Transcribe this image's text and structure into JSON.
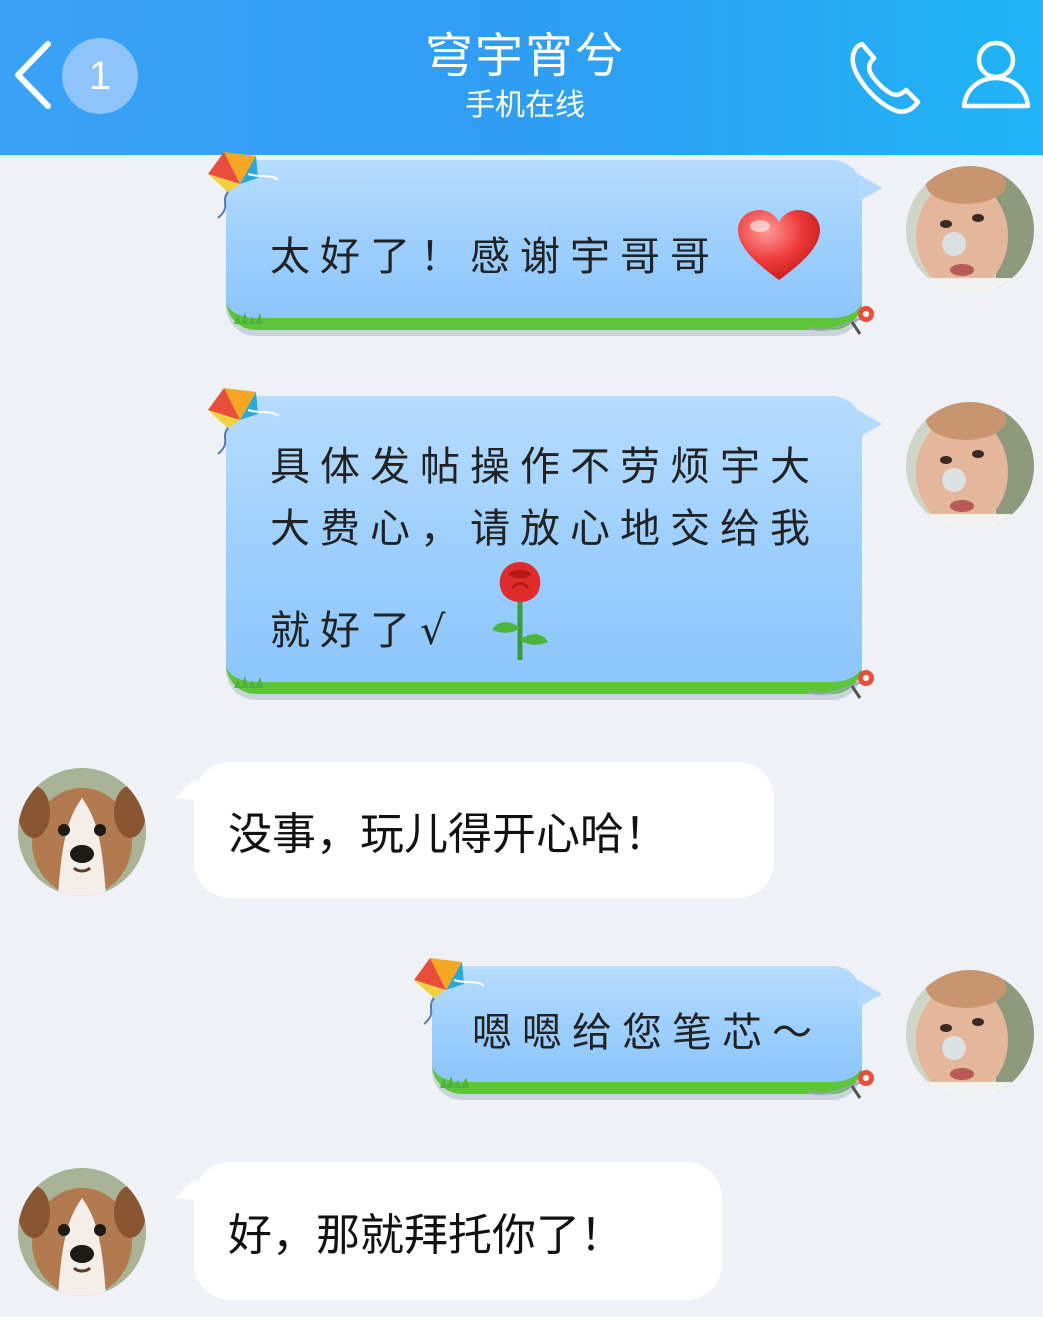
{
  "header": {
    "unread_count": "1",
    "contact_name": "穹宇宵兮",
    "status": "手机在线",
    "back_icon": "back-chevron-icon",
    "call_icon": "phone-icon",
    "profile_icon": "profile-icon"
  },
  "colors": {
    "header_start": "#3aa2f6",
    "header_end": "#1fb4f5",
    "chat_background": "#eef1f6",
    "bubble_blue": "#9ccffd",
    "bubble_grass": "#5cc53a",
    "bubble_white": "#ffffff"
  },
  "messages": [
    {
      "side": "right",
      "text": "太好了！感谢宇哥哥",
      "emoji": "heart-emoji"
    },
    {
      "side": "right",
      "lines": [
        "具体发帖操作不劳烦宇大",
        "大费心，请放心地交给我",
        "就好了√"
      ],
      "emoji": "rose-emoji"
    },
    {
      "side": "left",
      "text": "没事，玩儿得开心哈！"
    },
    {
      "side": "right",
      "text": "嗯嗯给您笔芯～"
    },
    {
      "side": "left",
      "text": "好，那就拜托你了！"
    }
  ]
}
